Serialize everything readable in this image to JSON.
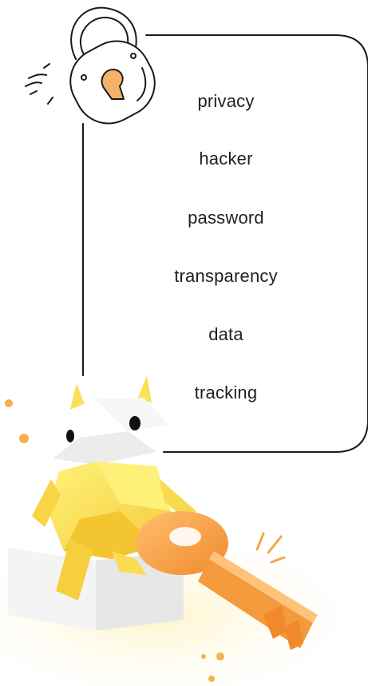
{
  "words": [
    "privacy",
    "hacker",
    "password",
    "transparency",
    "data",
    "tracking"
  ],
  "colors": {
    "outline": "#1a1a1a",
    "keyhole": "#f6b26b",
    "robot_body": "#fbe05a",
    "key": "#f5a347",
    "block": "#f3f3f3"
  },
  "icons": [
    "padlock-icon",
    "robot-figure",
    "key-figure"
  ]
}
